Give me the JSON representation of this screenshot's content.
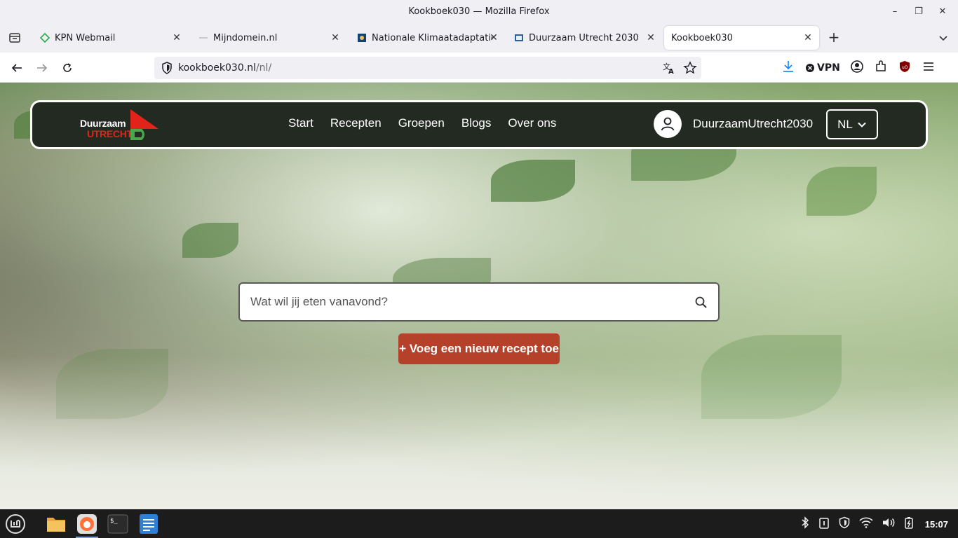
{
  "window": {
    "title": "Kookboek030 — Mozilla Firefox"
  },
  "tabs": [
    {
      "label": "KPN Webmail",
      "active": false
    },
    {
      "label": "Mijndomein.nl",
      "active": false
    },
    {
      "label": "Nationale Klimaatadaptatie:",
      "active": false
    },
    {
      "label": "Duurzaam Utrecht 2030",
      "active": false
    },
    {
      "label": "Kookboek030",
      "active": true
    }
  ],
  "urlbar": {
    "host": "kookboek030.nl",
    "path": "/nl/"
  },
  "toolbar": {
    "vpn_label": "VPN"
  },
  "site": {
    "logo_line1": "Duurzaam",
    "logo_line2": "UTRECHT",
    "nav": [
      "Start",
      "Recepten",
      "Groepen",
      "Blogs",
      "Over ons"
    ],
    "username": "DuurzaamUtrecht2030",
    "language": "NL",
    "search_placeholder": "Wat wil jij eten vanavond?",
    "add_recipe": "+ Voeg een nieuw recept toe"
  },
  "taskbar": {
    "clock": "15:07"
  },
  "colors": {
    "header_bg": "#232a22",
    "button_bg": "#b5412a",
    "logo_red": "#e2231a"
  }
}
